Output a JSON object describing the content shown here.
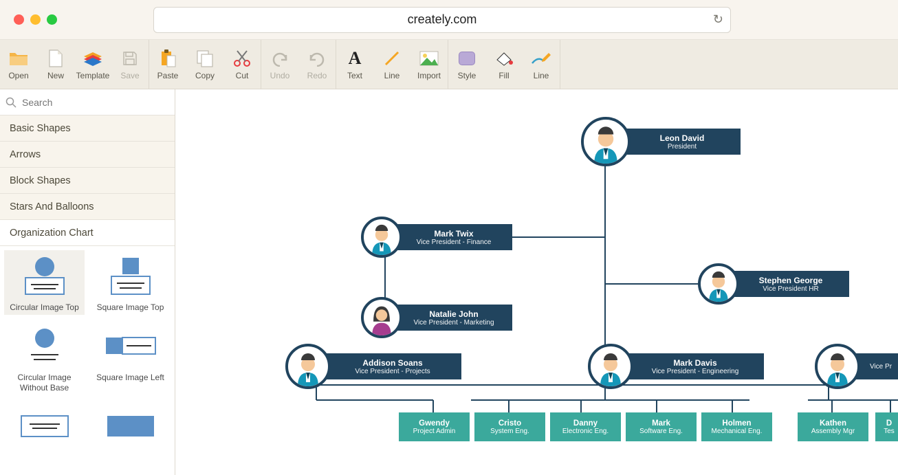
{
  "browser": {
    "url": "creately.com"
  },
  "toolbar": {
    "open": "Open",
    "new": "New",
    "template": "Template",
    "save": "Save",
    "paste": "Paste",
    "copy": "Copy",
    "cut": "Cut",
    "undo": "Undo",
    "redo": "Redo",
    "text": "Text",
    "line": "Line",
    "import": "Import",
    "style": "Style",
    "fill": "Fill",
    "line2": "Line"
  },
  "sidebar": {
    "search_placeholder": "Search",
    "cats": [
      "Basic Shapes",
      "Arrows",
      "Block Shapes",
      "Stars And Balloons",
      "Organization Chart"
    ],
    "shapes": [
      "Circular Image Top",
      "Square Image Top",
      "Circular Image Without Base",
      "Square Image Left"
    ]
  },
  "chart": {
    "nodes": [
      {
        "id": "n0",
        "name": "Leon David",
        "title": "President"
      },
      {
        "id": "n1",
        "name": "Mark Twix",
        "title": "Vice President - Finance"
      },
      {
        "id": "n2",
        "name": "Stephen George",
        "title": "Vice President HR"
      },
      {
        "id": "n3",
        "name": "Natalie John",
        "title": "Vice President - Marketing"
      },
      {
        "id": "n4",
        "name": "Addison Soans",
        "title": "Vice President - Projects"
      },
      {
        "id": "n5",
        "name": "Mark Davis",
        "title": "Vice President - Engineering"
      },
      {
        "id": "n6",
        "name": "",
        "title": "Vice Pr"
      }
    ],
    "small": [
      {
        "name": "Gwendy",
        "title": "Project Admin"
      },
      {
        "name": "Cristo",
        "title": "System Eng."
      },
      {
        "name": "Danny",
        "title": "Electronic Eng."
      },
      {
        "name": "Mark",
        "title": "Software Eng."
      },
      {
        "name": "Holmen",
        "title": "Mechanical Eng."
      },
      {
        "name": "Kathen",
        "title": "Assembly Mgr"
      },
      {
        "name": "D",
        "title": "Tes"
      }
    ]
  }
}
